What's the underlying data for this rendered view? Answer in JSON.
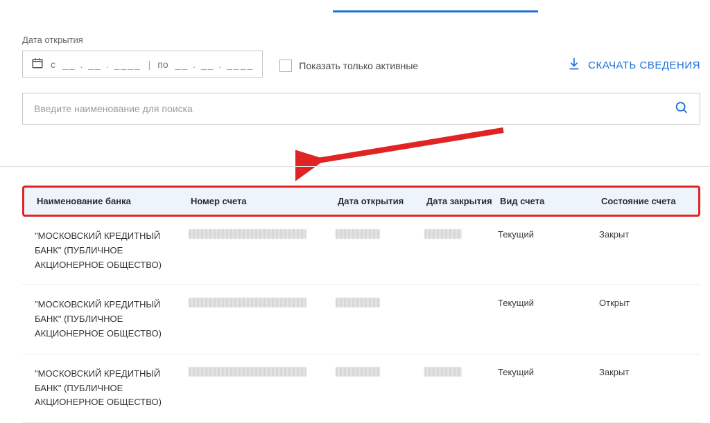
{
  "filters": {
    "date_label": "Дата открытия",
    "from_prefix": "с",
    "to_prefix": "по",
    "active_only_label": "Показать только активные"
  },
  "actions": {
    "download_label": "СКАЧАТЬ СВЕДЕНИЯ"
  },
  "search": {
    "placeholder": "Введите наименование для поиска"
  },
  "table": {
    "headers": {
      "bank": "Наименование банка",
      "account": "Номер счета",
      "open_date": "Дата открытия",
      "close_date": "Дата закрытия",
      "type": "Вид счета",
      "state": "Состояние счета"
    },
    "rows": [
      {
        "bank": "\"МОСКОВСКИЙ КРЕДИТНЫЙ БАНК\" (ПУБЛИЧНОЕ АКЦИОНЕРНОЕ ОБЩЕСТВО)",
        "type": "Текущий",
        "state": "Закрыт",
        "has_close": true
      },
      {
        "bank": "\"МОСКОВСКИЙ КРЕДИТНЫЙ БАНК\" (ПУБЛИЧНОЕ АКЦИОНЕРНОЕ ОБЩЕСТВО)",
        "type": "Текущий",
        "state": "Открыт",
        "has_close": false
      },
      {
        "bank": "\"МОСКОВСКИЙ КРЕДИТНЫЙ БАНК\" (ПУБЛИЧНОЕ АКЦИОНЕРНОЕ ОБЩЕСТВО)",
        "type": "Текущий",
        "state": "Закрыт",
        "has_close": true
      }
    ]
  }
}
